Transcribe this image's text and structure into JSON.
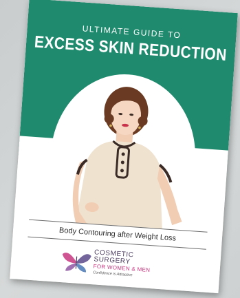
{
  "cover": {
    "eyebrow": "ULTIMATE GUIDE TO",
    "title": "EXCESS SKIN REDUCTION",
    "subtitle": "Body Contouring after Weight Loss"
  },
  "logo": {
    "line1": "COSMETIC",
    "line2": "SURGERY",
    "line3": "FOR WOMEN & MEN",
    "line4": "Confidence is Attractive"
  },
  "colors": {
    "header_green": "#1f8a6d",
    "background_gray": "#cdd1d1",
    "logo_purple": "#4b3b5e",
    "logo_pink": "#c6367f"
  },
  "icons": {
    "logo_mark": "butterfly-icon"
  }
}
